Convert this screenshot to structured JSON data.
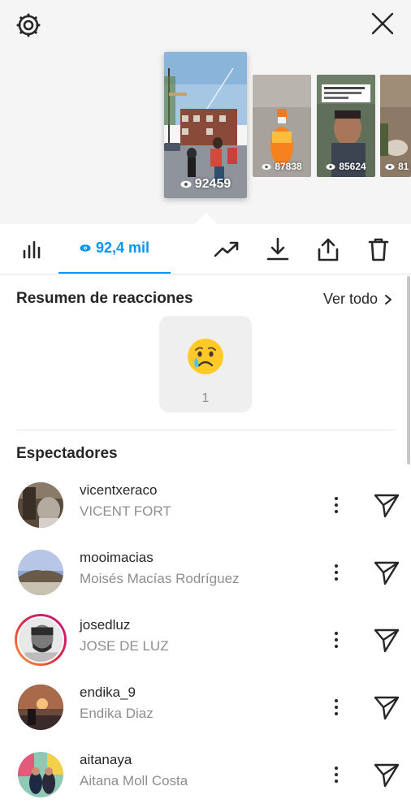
{
  "header": {
    "settings_icon": "settings-gear-icon",
    "close_icon": "close-icon"
  },
  "stories": [
    {
      "views": "92459",
      "selected": true
    },
    {
      "views": "87838"
    },
    {
      "views": "85624"
    },
    {
      "views": "81"
    }
  ],
  "tabs": {
    "views_label": "92,4 mil",
    "icons": [
      "bar-chart-icon",
      "eye-icon",
      "trending-up-icon",
      "download-icon",
      "share-icon",
      "trash-icon"
    ]
  },
  "reactions": {
    "title": "Resumen de reacciones",
    "see_all": "Ver todo",
    "items": [
      {
        "emoji": "crying-face",
        "count": "1"
      }
    ]
  },
  "viewers": {
    "title": "Espectadores",
    "list": [
      {
        "username": "vicentxeraco",
        "full_name": "VICENT FORT"
      },
      {
        "username": "mooimacias",
        "full_name": "Moisés Macías Rodríguez"
      },
      {
        "username": "josedluz",
        "full_name": "JOSE DE LUZ",
        "has_story_ring": true
      },
      {
        "username": "endika_9",
        "full_name": "Endika Diaz"
      },
      {
        "username": "aitanaya",
        "full_name": "Aitana Moll Costa"
      }
    ]
  },
  "colors": {
    "accent": "#0095f6",
    "text": "#262626",
    "secondary": "#8e8e8e"
  }
}
